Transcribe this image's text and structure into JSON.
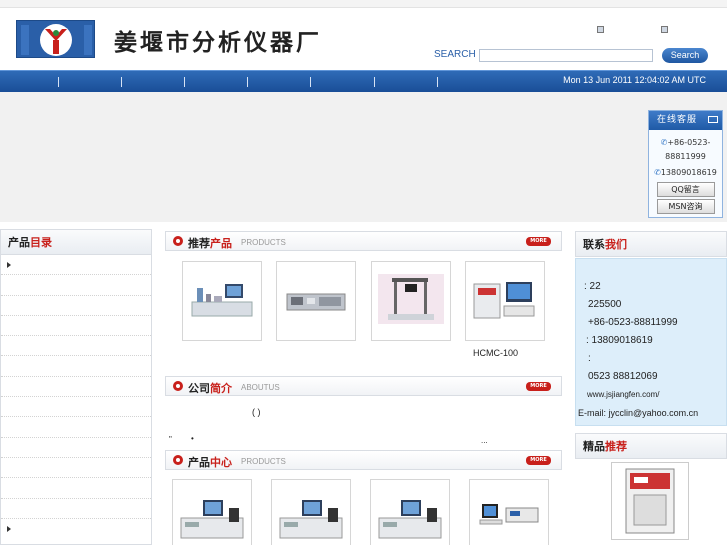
{
  "header": {
    "company_name": "姜堰市分析仪器厂",
    "search_label": "SEARCH",
    "search_placeholder": "",
    "search_button": "Search"
  },
  "nav": {
    "date": "Mon 13 Jun 2011 12:04:02 AM UTC"
  },
  "online_service": {
    "title": "在线客服",
    "phone1": "+86-0523-88811999",
    "phone2": "13809018619",
    "qq_button": "QQ留言",
    "msn_button": "MSN咨询"
  },
  "left": {
    "title_a": "产品",
    "title_b": "目录"
  },
  "recommended": {
    "title_a": "推荐",
    "title_b": "产品",
    "subtitle": "PRODUCTS",
    "more": "MORE",
    "caption": "HCMC-100"
  },
  "about": {
    "title_a": "公司",
    "title_b": "简介",
    "subtitle": "ABOUTUS",
    "more": "MORE",
    "text1": "( )",
    "text2": "\"",
    "text3": "•",
    "text4": "..."
  },
  "products_center": {
    "title_a": "产品",
    "title_b": "中心",
    "subtitle": "PRODUCTS",
    "more": "MORE"
  },
  "contact": {
    "title_a": "联系",
    "title_b": "我们",
    "line1": ":      22",
    "line2": "225500",
    "line3": "+86-0523-88811999",
    "line4": ": 13809018619",
    "line5": ":",
    "line6": "0523 88812069",
    "line7": "www.jsjiangfen.com/",
    "line8": "E-mail: jycclin@yahoo.com.cn"
  },
  "featured": {
    "title_a": "精品",
    "title_b": "推荐"
  },
  "colors": {
    "accent": "#c8201b",
    "nav_blue": "#1f57a1",
    "contact_bg": "#ddeefa"
  }
}
